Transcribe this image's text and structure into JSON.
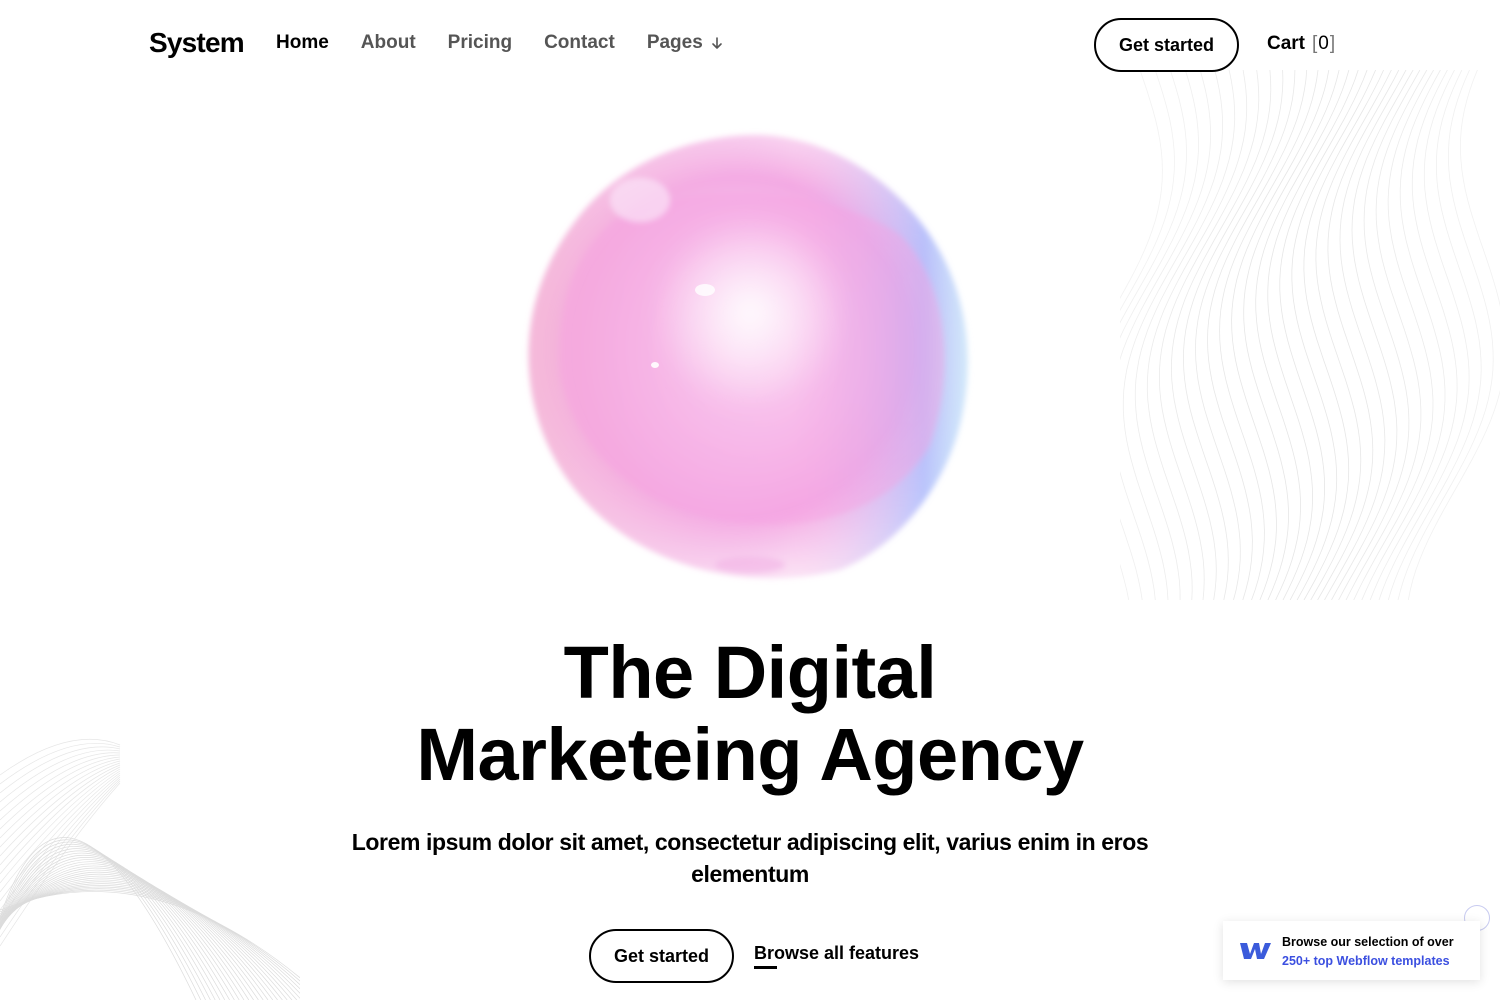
{
  "header": {
    "logo": "System",
    "nav": [
      {
        "label": "Home",
        "active": true
      },
      {
        "label": "About",
        "active": false
      },
      {
        "label": "Pricing",
        "active": false
      },
      {
        "label": "Contact",
        "active": false
      }
    ],
    "pages_label": "Pages",
    "cta_label": "Get started",
    "cart": {
      "label": "Cart",
      "open_bracket": "[",
      "count": "0",
      "close_bracket": "]"
    }
  },
  "hero": {
    "title_line1": "The Digital",
    "title_line2": "Marketeing Agency",
    "subtitle": "Lorem ipsum dolor sit amet, consectetur adipiscing elit, varius enim in eros elementum",
    "primary_button": "Get started",
    "secondary_link": "Browse all features"
  },
  "badge": {
    "line1": "Browse our selection of over",
    "line2": "250+ top Webflow templates"
  },
  "colors": {
    "accent_link": "#3b4fe0",
    "orb_pink": "#f7a6e6",
    "orb_blue": "#8fb6ff"
  },
  "icons": {
    "pages_dropdown": "arrow-down-icon",
    "badge_logo": "webflow-logo-icon"
  }
}
